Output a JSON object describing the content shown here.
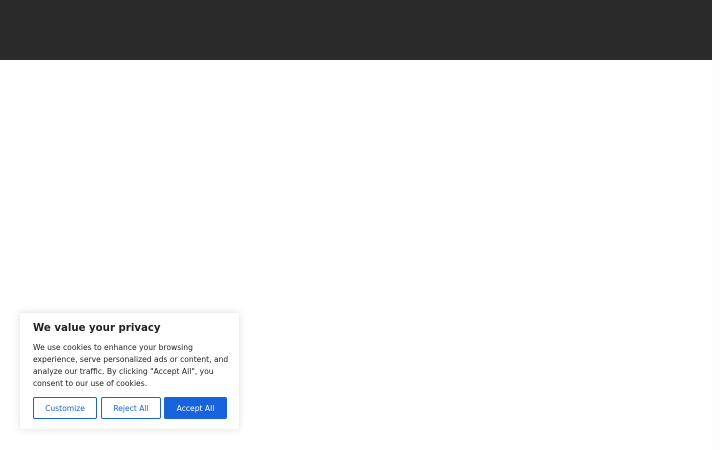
{
  "colors": {
    "header_background": "#2a2a2a",
    "page_background": "#ffffff",
    "accent": "#1863dc",
    "text": "#212121"
  },
  "cookie_consent": {
    "title": "We value your privacy",
    "body": "We use cookies to enhance your browsing experience, serve personalized ads or content, and analyze our traffic. By clicking \"Accept All\", you consent to our use of cookies.",
    "buttons": {
      "customize": "Customize",
      "reject_all": "Reject All",
      "accept_all": "Accept All"
    }
  }
}
